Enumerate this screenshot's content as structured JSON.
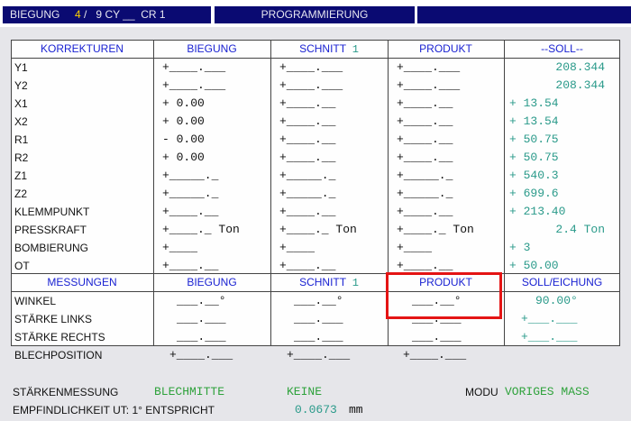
{
  "title_bar": {
    "mode": "BIEGUNG",
    "step": "4",
    "step_sep": "/",
    "step_total": "9",
    "cy": "CY __",
    "cr": "CR 1",
    "screen": "PROGRAMMIERUNG"
  },
  "table": {
    "headers": {
      "korrekturen": "KORREKTUREN",
      "biegung": "BIEGUNG",
      "schnitt": "SCHNITT",
      "schnitt_num": "1",
      "produkt": "PRODUKT",
      "soll": "--SOLL--"
    },
    "rows": [
      {
        "label": "Y1",
        "biegung": "+____.___",
        "schnitt": "+____.___",
        "produkt": "+____.___",
        "soll": "208.344"
      },
      {
        "label": "Y2",
        "biegung": "+____.___",
        "schnitt": "+____.___",
        "produkt": "+____.___",
        "soll": "208.344"
      },
      {
        "label": "X1",
        "biegung": "+   0.00",
        "schnitt": "+____.__",
        "produkt": "+____.__",
        "soll": "+  13.54"
      },
      {
        "label": "X2",
        "biegung": "+   0.00",
        "schnitt": "+____.__",
        "produkt": "+____.__",
        "soll": "+  13.54"
      },
      {
        "label": "R1",
        "biegung": "-   0.00",
        "schnitt": "+____.__",
        "produkt": "+____.__",
        "soll": "+  50.75"
      },
      {
        "label": "R2",
        "biegung": "+   0.00",
        "schnitt": "+____.__",
        "produkt": "+____.__",
        "soll": "+  50.75"
      },
      {
        "label": "Z1",
        "biegung": "+_____._",
        "schnitt": "+_____._",
        "produkt": "+_____._",
        "soll": "+  540.3"
      },
      {
        "label": "Z2",
        "biegung": "+_____._",
        "schnitt": "+_____._",
        "produkt": "+_____._",
        "soll": "+  699.6"
      },
      {
        "label": "KLEMMPUNKT",
        "biegung": "+____.__",
        "schnitt": "+____.__",
        "produkt": "+____.__",
        "soll": "+ 213.40"
      },
      {
        "label": "PRESSKRAFT",
        "biegung": "+____._ Ton",
        "schnitt": "+____._ Ton",
        "produkt": "+____._ Ton",
        "soll": "2.4 Ton"
      },
      {
        "label": "BOMBIERUNG",
        "biegung": "+____",
        "schnitt": "+____",
        "produkt": "+____",
        "soll": "+  3"
      },
      {
        "label": "OT",
        "biegung": "+____.__",
        "schnitt": "+____.__",
        "produkt": "+____.__",
        "soll": "+  50.00"
      }
    ],
    "meas_headers": {
      "messungen": "MESSUNGEN",
      "biegung": "BIEGUNG",
      "schnitt": "SCHNITT",
      "schnitt_num": "1",
      "produkt": "PRODUKT",
      "soll": "SOLL/EICHUNG"
    },
    "meas_rows": [
      {
        "label": "WINKEL",
        "biegung": "___.__°",
        "schnitt": "___.__°",
        "produkt": "___.__°",
        "soll": "90.00°"
      },
      {
        "label": "STÄRKE LINKS",
        "biegung": "___.___",
        "schnitt": "___.___",
        "produkt": "___.___",
        "soll": "+___.___"
      },
      {
        "label": "STÄRKE RECHTS",
        "biegung": "___.___",
        "schnitt": "___.___",
        "produkt": "___.___",
        "soll": "+___.___"
      },
      {
        "label": "BLECHPOSITION",
        "biegung": "+____.___",
        "schnitt": "+____.___",
        "produkt": "+____.___"
      }
    ]
  },
  "footer": {
    "staerke_label": "STÄRKENMESSUNG",
    "staerke_value": "BLECHMITTE",
    "keine": "KEINE",
    "modu_label": "MODU",
    "modu_value": "VORIGES MASS",
    "empf_label": "EMPFINDLICHKEIT UT: 1° ENTSPRICHT",
    "empf_value": "0.0673",
    "empf_unit": "mm"
  },
  "colors": {
    "title_bg": "#0a0a72",
    "header_text": "#1a22d2",
    "value_teal": "#2a9a8a",
    "value_green": "#2fa23c",
    "highlight": "#e41414"
  }
}
